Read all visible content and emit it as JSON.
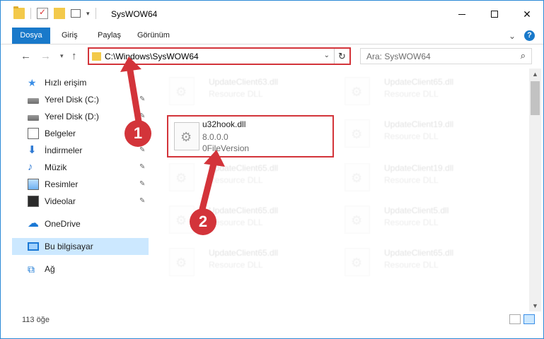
{
  "window": {
    "title": "SysWOW64",
    "minimize": "—",
    "close": "✕"
  },
  "ribbon": {
    "tabs": [
      "Dosya",
      "Giriş",
      "Paylaş",
      "Görünüm"
    ],
    "help": "?"
  },
  "address": {
    "path": "C:\\Windows\\SysWOW64",
    "refresh_icon": "↻",
    "dropdown_icon": "⌄"
  },
  "search": {
    "placeholder": "Ara: SysWOW64",
    "icon": "⌕"
  },
  "sidebar": {
    "items": [
      {
        "label": "Hızlı erişim",
        "icon": "quick-access-icon",
        "pinned": false
      },
      {
        "label": "Yerel Disk (C:)",
        "icon": "disk-icon",
        "pinned": true
      },
      {
        "label": "Yerel Disk (D:)",
        "icon": "disk-icon",
        "pinned": true
      },
      {
        "label": "Belgeler",
        "icon": "documents-icon",
        "pinned": true
      },
      {
        "label": "İndirmeler",
        "icon": "downloads-icon",
        "pinned": true
      },
      {
        "label": "Müzik",
        "icon": "music-icon",
        "pinned": true
      },
      {
        "label": "Resimler",
        "icon": "pictures-icon",
        "pinned": true
      },
      {
        "label": "Videolar",
        "icon": "videos-icon",
        "pinned": true
      },
      {
        "label": "OneDrive",
        "icon": "onedrive-icon",
        "pinned": false
      },
      {
        "label": "Bu bilgisayar",
        "icon": "this-pc-icon",
        "pinned": false,
        "selected": true
      },
      {
        "label": "Ağ",
        "icon": "network-icon",
        "pinned": false
      }
    ],
    "pin_glyph": "📌"
  },
  "files": {
    "highlighted": {
      "name": "u32hook.dll",
      "version": "8.0.0.0",
      "description": "0FileVersion"
    },
    "faded": [
      {
        "name": "UpdateClient63.dll",
        "type": "Resource DLL"
      },
      {
        "name": "UpdateClient65.dll",
        "type": "Resource DLL"
      },
      {
        "name": "UpdateClient19.dll",
        "type": "Resource DLL"
      },
      {
        "name": "UpdateClient65.dll",
        "type": "Resource DLL"
      },
      {
        "name": "UpdateClient19.dll",
        "type": "Resource DLL"
      },
      {
        "name": "UpdateClient65.dll",
        "type": "Resource DLL"
      },
      {
        "name": "UpdateClient5.dll",
        "type": "Resource DLL"
      },
      {
        "name": "UpdateClient65.dll",
        "type": "Resource DLL"
      },
      {
        "name": "UpdateClient65.dll",
        "type": "Resource DLL"
      }
    ]
  },
  "status": {
    "count": "113 öğe"
  },
  "annotations": {
    "step1": "1",
    "step2": "2",
    "color": "#d3343a"
  },
  "colors": {
    "accent": "#1979ca",
    "selection": "#cce8ff",
    "highlight_box": "#d3343a"
  }
}
